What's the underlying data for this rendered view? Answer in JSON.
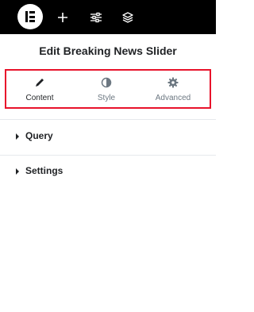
{
  "toolbar": {
    "icons": [
      "elementor-logo-icon",
      "add-icon",
      "settings-sliders-icon",
      "layers-icon"
    ]
  },
  "panel": {
    "title": "Edit Breaking News Slider"
  },
  "tabs": [
    {
      "label": "Content",
      "icon": "pencil-icon",
      "active": true
    },
    {
      "label": "Style",
      "icon": "half-circle-icon",
      "active": false
    },
    {
      "label": "Advanced",
      "icon": "gear-icon",
      "active": false
    }
  ],
  "sections": [
    {
      "title": "Query"
    },
    {
      "title": "Settings"
    }
  ],
  "colors": {
    "topbar": "#000000",
    "highlight_border": "#e8132b",
    "tab_inactive_text": "#6d7882",
    "text": "#1f2124"
  }
}
